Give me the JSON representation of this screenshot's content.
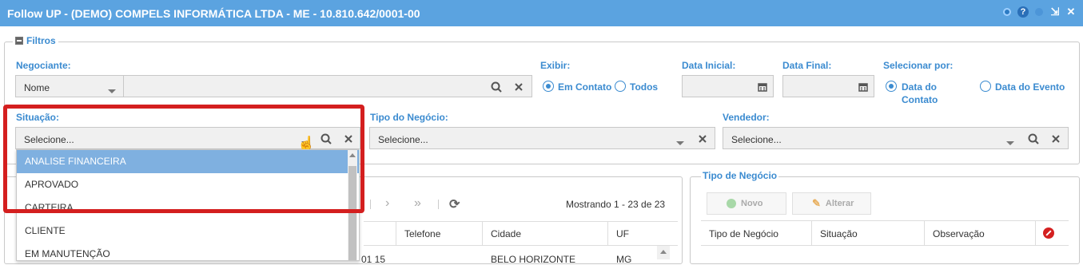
{
  "window": {
    "title": "Follow UP - (DEMO) COMPELS INFORMÁTICA LTDA - ME - 10.810.642/0001-00"
  },
  "filters": {
    "legend": "Filtros",
    "negociante": {
      "label": "Negociante:",
      "type_value": "Nome",
      "value": ""
    },
    "exibir": {
      "label": "Exibir:",
      "options": [
        "Em Contato",
        "Todos"
      ],
      "selected": "Em Contato"
    },
    "data_inicial": {
      "label": "Data Inicial:",
      "value": ""
    },
    "data_final": {
      "label": "Data Final:",
      "value": ""
    },
    "selecionar_por": {
      "label": "Selecionar por:",
      "options": [
        "Data do Contato",
        "Data do Evento"
      ],
      "option1_line1": "Data do",
      "option1_line2": "Contato",
      "option2": "Data do Evento",
      "selected": "Data do Contato"
    },
    "situacao": {
      "label": "Situação:",
      "placeholder": "Selecione..."
    },
    "tipo_negocio": {
      "label": "Tipo do Negócio:",
      "placeholder": "Selecione..."
    },
    "vendedor": {
      "label": "Vendedor:",
      "placeholder": "Selecione..."
    }
  },
  "situacao_dropdown": {
    "options": [
      "ANALISE FINANCEIRA",
      "APROVADO",
      "CARTEIRA",
      "CLIENTE",
      "EM MANUTENÇÃO"
    ],
    "highlighted": "ANALISE FINANCEIRA"
  },
  "grid": {
    "paging_status": "Mostrando 1 - 23 de 23",
    "columns": [
      "Telefone",
      "Cidade",
      "UF"
    ],
    "first_row": {
      "date_partial": "01 15",
      "cidade": "BELO HORIZONTE",
      "uf": "MG"
    }
  },
  "tipo_negocio_panel": {
    "title": "Tipo de Negócio",
    "buttons": {
      "novo": "Novo",
      "alterar": "Alterar"
    },
    "columns": [
      "Tipo de Negócio",
      "Situação",
      "Observação"
    ]
  },
  "colors": {
    "titlebar": "#5ba3e0",
    "accent": "#3b8bd0",
    "highlight_border": "#d41f1f",
    "selected_option": "#7fb0e0"
  }
}
